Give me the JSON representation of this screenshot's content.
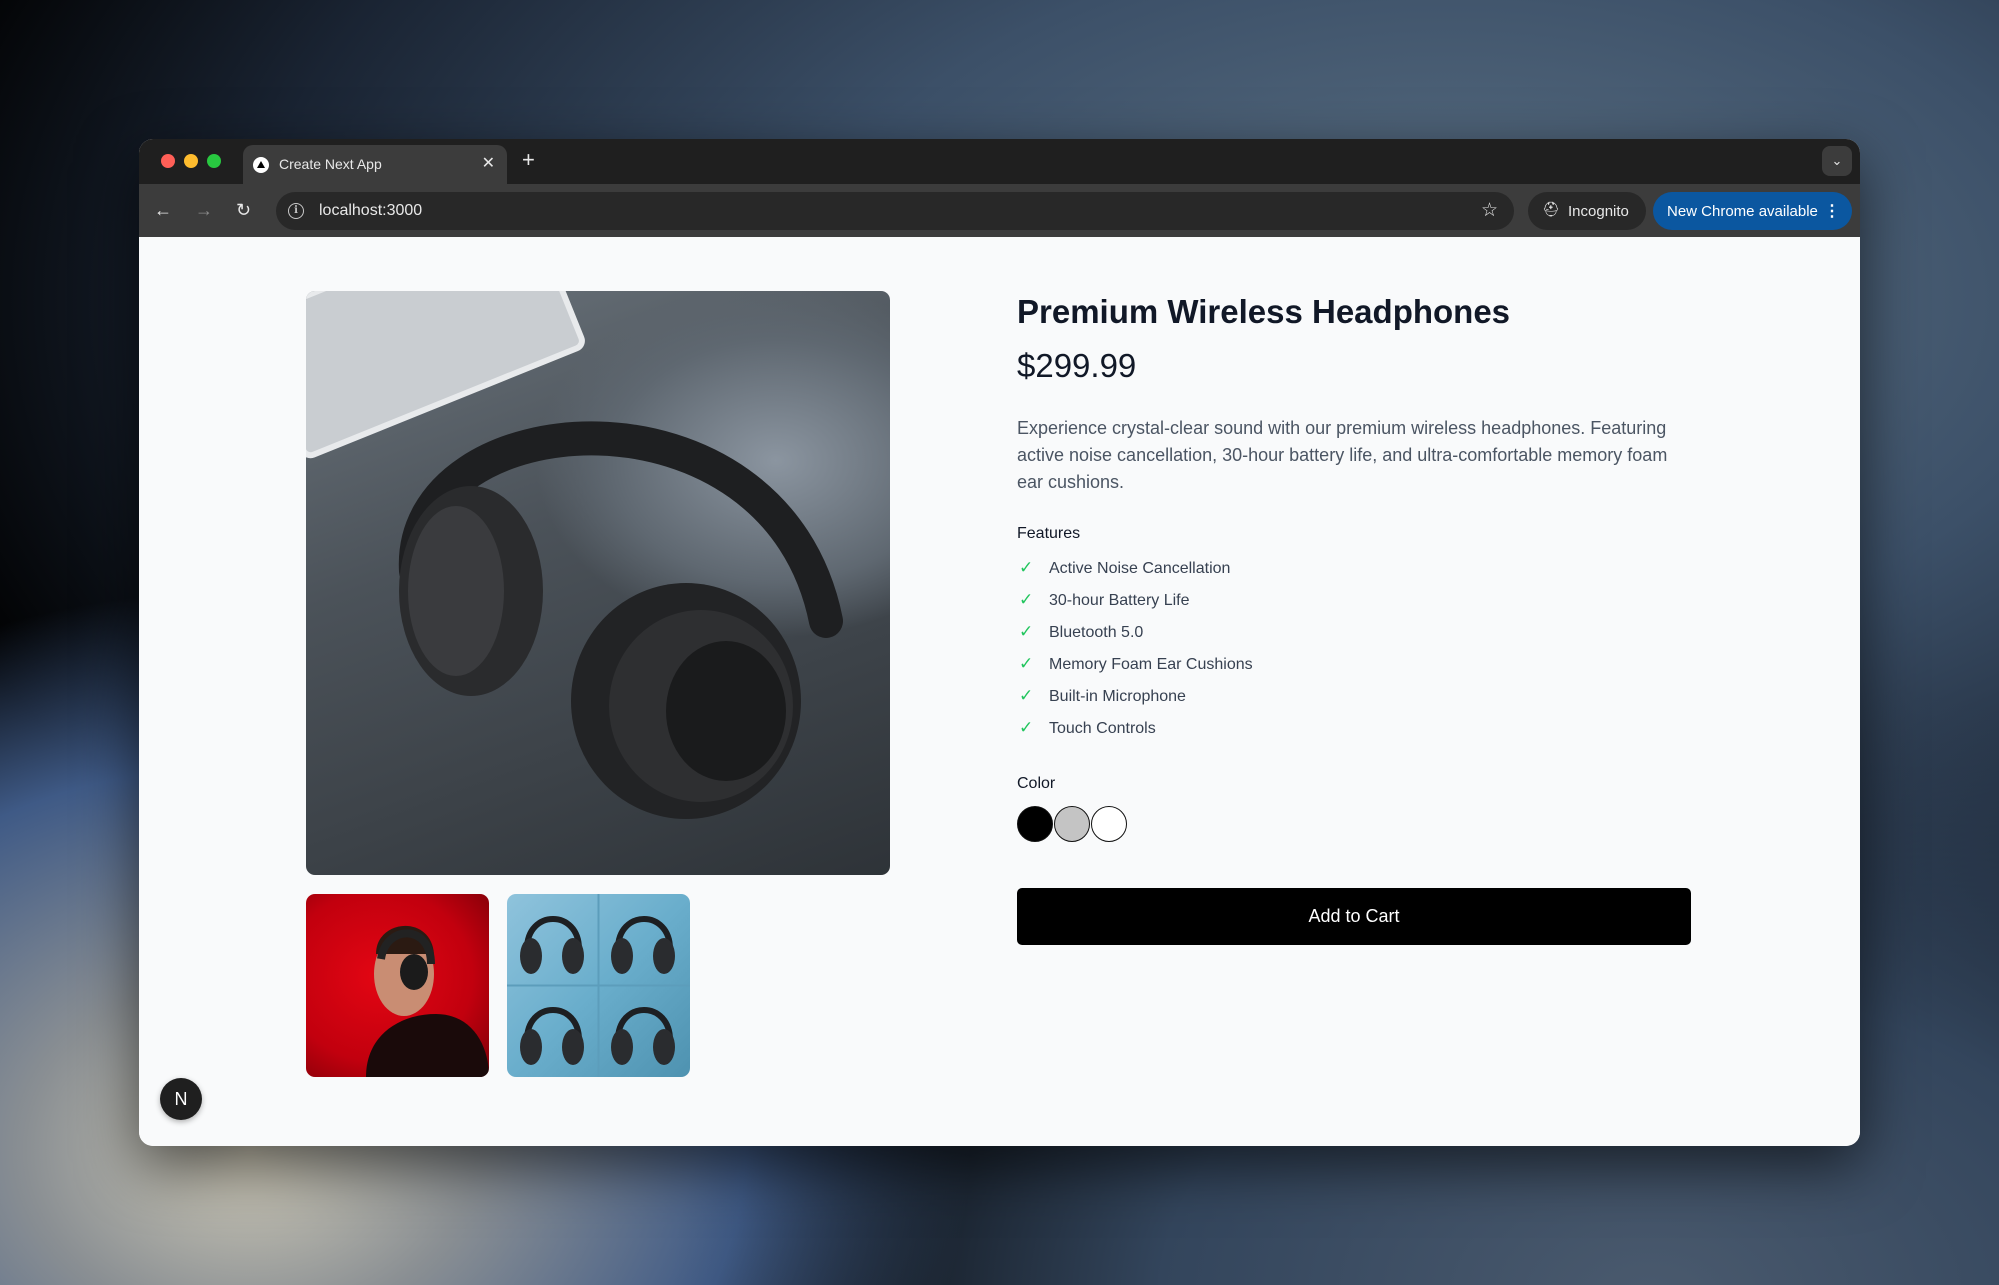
{
  "browser": {
    "tab": {
      "title": "Create Next App",
      "close_glyph": "✕"
    },
    "new_tab_glyph": "+",
    "tab_search_glyph": "⌄",
    "nav": {
      "back": "←",
      "forward": "→",
      "reload": "↻"
    },
    "address": {
      "url": "localhost:3000",
      "info_glyph": "i",
      "star_glyph": "☆"
    },
    "incognito": {
      "label": "Incognito",
      "icon_glyph": "⛑"
    },
    "update": {
      "label": "New Chrome available",
      "menu_glyph": "⋮",
      "color": "#0b57a0"
    }
  },
  "product": {
    "title": "Premium Wireless Headphones",
    "price": "$299.99",
    "description": "Experience crystal-clear sound with our premium wireless headphones. Featuring active noise cancellation, 30-hour battery life, and ultra-comfortable memory foam ear cushions.",
    "features_heading": "Features",
    "features": [
      "Active Noise Cancellation",
      "30-hour Battery Life",
      "Bluetooth 5.0",
      "Memory Foam Ear Cushions",
      "Built-in Microphone",
      "Touch Controls"
    ],
    "check_glyph": "✓",
    "check_color": "#22c55e",
    "color_heading": "Color",
    "colors": [
      "#000000",
      "#c4c4c4",
      "#ffffff"
    ],
    "add_to_cart": "Add to Cart"
  },
  "next_badge": "N"
}
